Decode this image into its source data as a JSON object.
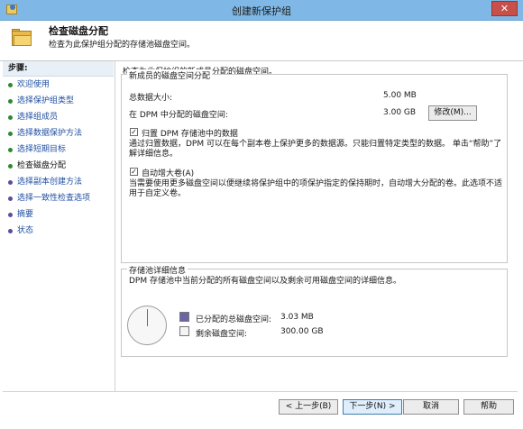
{
  "window": {
    "title": "创建新保护组",
    "close": "✕"
  },
  "header": {
    "title": "检查磁盘分配",
    "subtitle": "检查为此保护组分配的存储池磁盘空间。"
  },
  "steps": {
    "heading": "步骤:",
    "items": [
      {
        "label": "欢迎使用",
        "state": "done"
      },
      {
        "label": "选择保护组类型",
        "state": "done"
      },
      {
        "label": "选择组成员",
        "state": "done"
      },
      {
        "label": "选择数据保护方法",
        "state": "done"
      },
      {
        "label": "选择短期目标",
        "state": "done"
      },
      {
        "label": "检查磁盘分配",
        "state": "current"
      },
      {
        "label": "选择副本创建方法",
        "state": "todo"
      },
      {
        "label": "选择一致性检查选项",
        "state": "todo"
      },
      {
        "label": "摘要",
        "state": "todo"
      },
      {
        "label": "状态",
        "state": "todo"
      }
    ]
  },
  "main": {
    "intro": "检查为此保护组的新成员分配的磁盘空间。",
    "allocation": {
      "legend": "新成员的磁盘空间分配",
      "total_label": "总数据大小:",
      "total_value": "5.00 MB",
      "dpm_label": "在 DPM 中分配的磁盘空间:",
      "dpm_value": "3.00 GB",
      "modify_button": "修改(M)...",
      "colocate_label": "归置 DPM 存储池中的数据",
      "colocate_checked": true,
      "colocate_desc": "通过归置数据，DPM 可以在每个副本卷上保护更多的数据源。只能归置特定类型的数据。 单击“帮助”了解详细信息。",
      "autogrow_label": "自动增大卷(A)",
      "autogrow_checked": true,
      "autogrow_desc": "当需要使用更多磁盘空间以便继续将保护组中的项保护指定的保持期时，自动增大分配的卷。此选项不适用于自定义卷。"
    },
    "pool": {
      "legend": "存储池详细信息",
      "desc": "DPM 存储池中当前分配的所有磁盘空间以及剩余可用磁盘空间的详细信息。",
      "allocated_label": "已分配的总磁盘空间:",
      "allocated_value": "3.03 MB",
      "allocated_color": "#6b64a6",
      "free_label": "剩余磁盘空间:",
      "free_value": "300.00 GB",
      "free_color": "#f4f4f4"
    }
  },
  "footer": {
    "back": "< 上一步(B)",
    "next": "下一步(N) >",
    "cancel": "取消",
    "help": "帮助"
  }
}
